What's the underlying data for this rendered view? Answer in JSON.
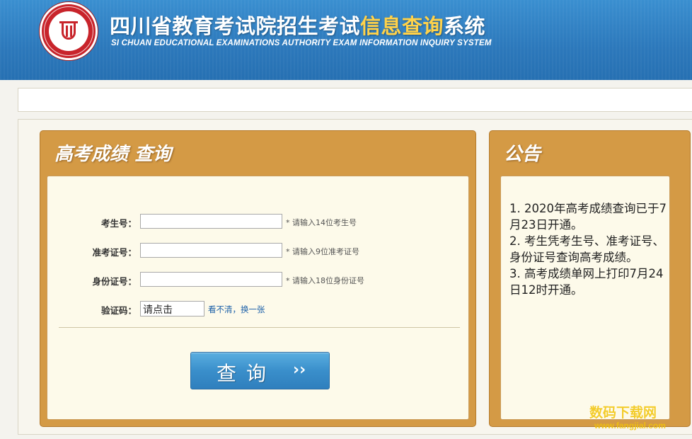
{
  "header": {
    "title_prefix": "四川省教育考试院招生考试",
    "title_highlight": "信息查询",
    "title_suffix": "系统",
    "subtitle": "SI CHUAN EDUCATIONAL EXAMINATIONS AUTHORITY EXAM INFORMATION INQUIRY SYSTEM",
    "logo": "sichuan-education-exam-authority-seal",
    "colors": {
      "header_bg": "#2c78bb",
      "title_highlight": "#ffd24a",
      "panel": "#d49a45"
    }
  },
  "query_panel": {
    "title": "高考成绩  查询",
    "fields": [
      {
        "label": "考生号：",
        "value": "",
        "hint": "* 请输入14位考生号"
      },
      {
        "label": "准考证号：",
        "value": "",
        "hint": "* 请输入9位准考证号"
      },
      {
        "label": "身份证号：",
        "value": "",
        "hint": "* 请输入18位身份证号"
      }
    ],
    "captcha": {
      "label": "验证码：",
      "image_text": "请点击",
      "refresh_link": "看不清，换一张"
    },
    "submit": {
      "label": "查询",
      "arrow": "››"
    }
  },
  "notice_panel": {
    "title": "公告",
    "items": [
      "1. 2020年高考成绩查询已于7月23日开通。",
      "2. 考生凭考生号、准考证号、身份证号查询高考成绩。",
      "3. 高考成绩单网上打印7月24日12时开通。"
    ]
  },
  "watermark": {
    "text": "数码下载网",
    "url": "www.fangjial.com"
  }
}
